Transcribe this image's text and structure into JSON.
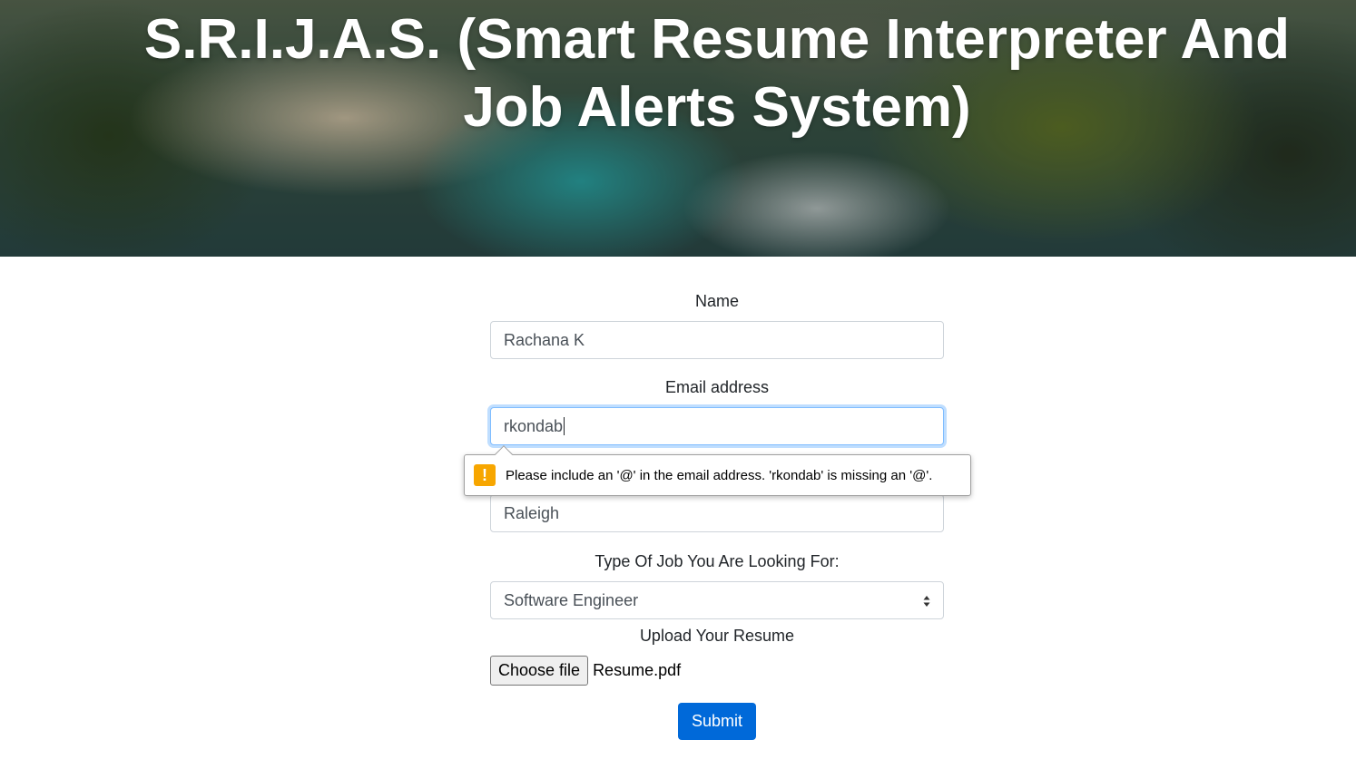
{
  "header": {
    "title_line1": "S.R.I.J.A.S. (Smart Resume Interpreter And",
    "title_line2": "Job Alerts System)"
  },
  "form": {
    "name_label": "Name",
    "name_value": "Rachana K",
    "email_label": "Email address",
    "email_value": "rkondab",
    "location_value": "Raleigh",
    "job_type_label": "Type Of Job You Are Looking For:",
    "job_type_value": "Software Engineer",
    "resume_label": "Upload Your Resume",
    "choose_file_label": "Choose file",
    "file_name": "Resume.pdf",
    "submit_label": "Submit"
  },
  "validation": {
    "message": "Please include an '@' in the email address. 'rkondab' is missing an '@'.",
    "icon": "!",
    "icon_color": "#f7a600"
  },
  "colors": {
    "primary": "#0069d9",
    "focus_border": "#80bdff"
  }
}
